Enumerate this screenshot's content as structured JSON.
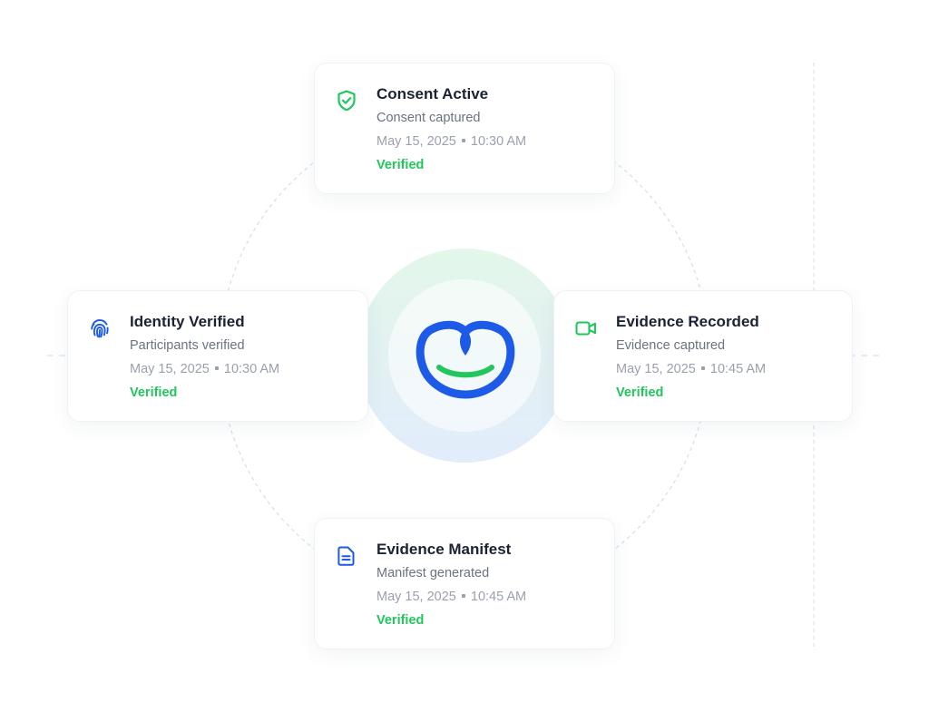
{
  "theme": {
    "accent_blue": "#1d5ae8",
    "accent_green": "#22c55e",
    "title_color": "#1a2233",
    "subtitle_color": "#6b7280",
    "muted_color": "#9aa1ad"
  },
  "cards": {
    "consent": {
      "icon": "shield-check-icon",
      "title": "Consent Active",
      "subtitle": "Consent captured",
      "date": "May 15, 2025",
      "time": "10:30 AM",
      "status": "Verified"
    },
    "identity": {
      "icon": "fingerprint-icon",
      "title": "Identity Verified",
      "subtitle": "Participants verified",
      "date": "May 15, 2025",
      "time": "10:30 AM",
      "status": "Verified"
    },
    "evidence": {
      "icon": "video-camera-icon",
      "title": "Evidence Recorded",
      "subtitle": "Evidence captured",
      "date": "May 15, 2025",
      "time": "10:45 AM",
      "status": "Verified"
    },
    "manifest": {
      "icon": "document-icon",
      "title": "Evidence Manifest",
      "subtitle": "Manifest generated",
      "date": "May 15, 2025",
      "time": "10:45 AM",
      "status": "Verified"
    }
  },
  "center": {
    "icon": "heart-smile-logo-icon"
  }
}
